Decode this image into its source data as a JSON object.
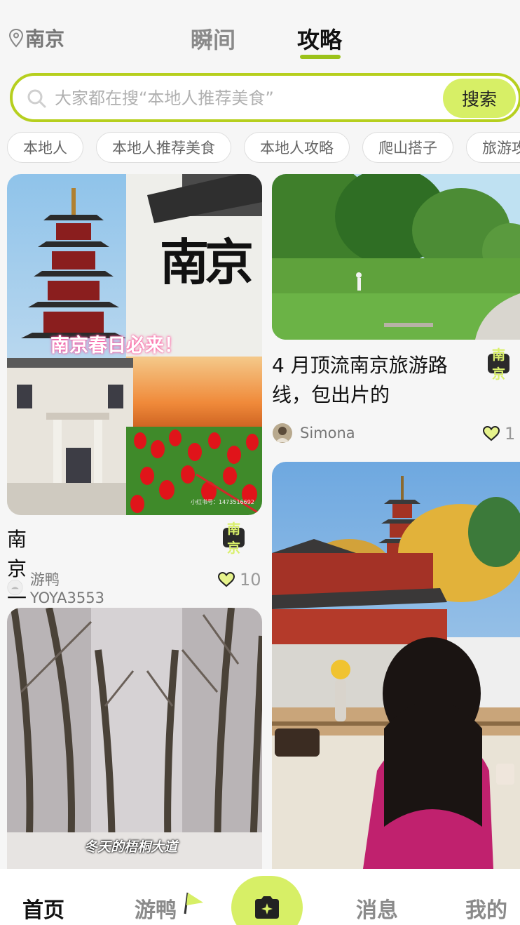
{
  "header": {
    "location": "南京",
    "tabs": [
      {
        "label": "瞬间",
        "active": false
      },
      {
        "label": "攻略",
        "active": true
      }
    ]
  },
  "search": {
    "placeholder": "大家都在搜“本地人推荐美食”",
    "button_label": "搜索"
  },
  "tags": [
    "本地人",
    "本地人推荐美食",
    "本地人攻略",
    "爬山搭子",
    "旅游攻"
  ],
  "cards": [
    {
      "image_text_1": "南京",
      "image_text_2": "南京春日必来！",
      "image_watermark": "小红书号：1473516692",
      "title": "南京一日游",
      "city": "南京",
      "author": "游鸭YOYA3553",
      "likes": "10"
    },
    {
      "title": "4 月顶流南京旅游路线，包出片的",
      "city": "南京",
      "author": "Simona",
      "likes": "1"
    },
    {
      "image_text": "冬天的梧桐大道"
    },
    {}
  ],
  "bottom_nav": {
    "items": [
      "首页",
      "游鸭",
      "消息",
      "我的"
    ],
    "active": "首页"
  },
  "colors": {
    "accent": "#d7ef66",
    "accent_border": "#b6cf1e",
    "tab_underline": "#9bc21a"
  }
}
